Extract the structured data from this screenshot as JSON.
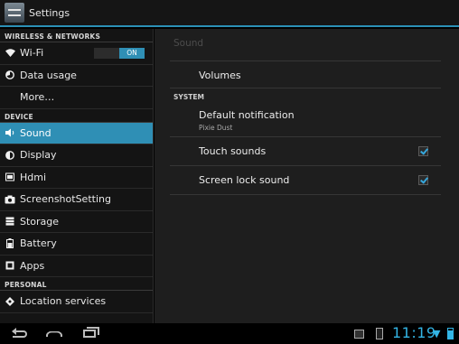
{
  "actionbar": {
    "title": "Settings",
    "icon": "settings-icon"
  },
  "left_pane": {
    "sections": [
      {
        "header": "WIRELESS & NETWORKS",
        "items": [
          {
            "label": "Wi-Fi",
            "icon": "wifi-icon",
            "toggle": "ON"
          },
          {
            "label": "Data usage",
            "icon": "data-usage-icon"
          },
          {
            "label": "More…"
          }
        ]
      },
      {
        "header": "DEVICE",
        "items": [
          {
            "label": "Sound",
            "icon": "volume-icon",
            "selected": true
          },
          {
            "label": "Display",
            "icon": "brightness-icon"
          },
          {
            "label": "Hdmi",
            "icon": "hdmi-icon"
          },
          {
            "label": "ScreenshotSetting",
            "icon": "camera-icon"
          },
          {
            "label": "Storage",
            "icon": "storage-icon"
          },
          {
            "label": "Battery",
            "icon": "battery-icon"
          },
          {
            "label": "Apps",
            "icon": "apps-icon"
          }
        ]
      },
      {
        "header": "PERSONAL",
        "items": [
          {
            "label": "Location services",
            "icon": "location-icon"
          }
        ]
      }
    ]
  },
  "right_pane": {
    "title": "Sound",
    "volumes_label": "Volumes",
    "system_header": "SYSTEM",
    "default_notification": {
      "label": "Default notification",
      "summary": "Pixie Dust"
    },
    "touch_sounds": {
      "label": "Touch sounds",
      "checked": true
    },
    "screen_lock_sound": {
      "label": "Screen lock sound",
      "checked": true
    }
  },
  "status_bar": {
    "clock": "11:19",
    "accent_color": "#33b5e5"
  },
  "colors": {
    "selected": "#2f8fb5",
    "accent": "#33b5e5"
  }
}
